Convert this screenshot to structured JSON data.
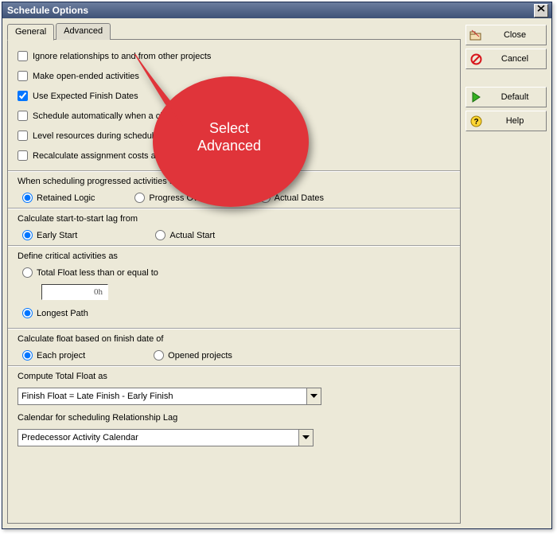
{
  "window": {
    "title": "Schedule Options"
  },
  "tabs": {
    "general": "General",
    "advanced": "Advanced"
  },
  "checkboxes": {
    "ignore_rel": {
      "label": "Ignore relationships to and from other projects",
      "checked": false
    },
    "open_ended": {
      "label": "Make open-ended activities",
      "checked": false
    },
    "expected_finish": {
      "label": "Use Expected Finish Dates",
      "checked": true
    },
    "auto_sched": {
      "label": "Schedule automatically when a change",
      "checked": false
    },
    "level_res": {
      "label": "Level resources during scheduling",
      "checked": false
    },
    "recalc_costs": {
      "label": "Recalculate assignment costs after s",
      "checked": false
    }
  },
  "sched_prog": {
    "label": "When scheduling progressed activities use",
    "retained": "Retained Logic",
    "override": "Progress Override",
    "actual": "Actual Dates"
  },
  "lag_from": {
    "label": "Calculate start-to-start lag from",
    "early": "Early Start",
    "actual": "Actual Start"
  },
  "critical": {
    "label": "Define critical activities as",
    "float_lte": "Total Float less than or equal to",
    "value": "0h",
    "longest": "Longest Path"
  },
  "float_based": {
    "label": "Calculate float based on finish date of",
    "each": "Each project",
    "opened": "Opened projects"
  },
  "compute_float": {
    "label": "Compute Total Float as",
    "value": "Finish Float = Late Finish - Early Finish"
  },
  "calendar_lag": {
    "label": "Calendar for scheduling Relationship Lag",
    "value": "Predecessor Activity Calendar"
  },
  "buttons": {
    "close": "Close",
    "cancel": "Cancel",
    "default": "Default",
    "help": "Help"
  },
  "callout": {
    "line1": "Select",
    "line2": "Advanced"
  }
}
